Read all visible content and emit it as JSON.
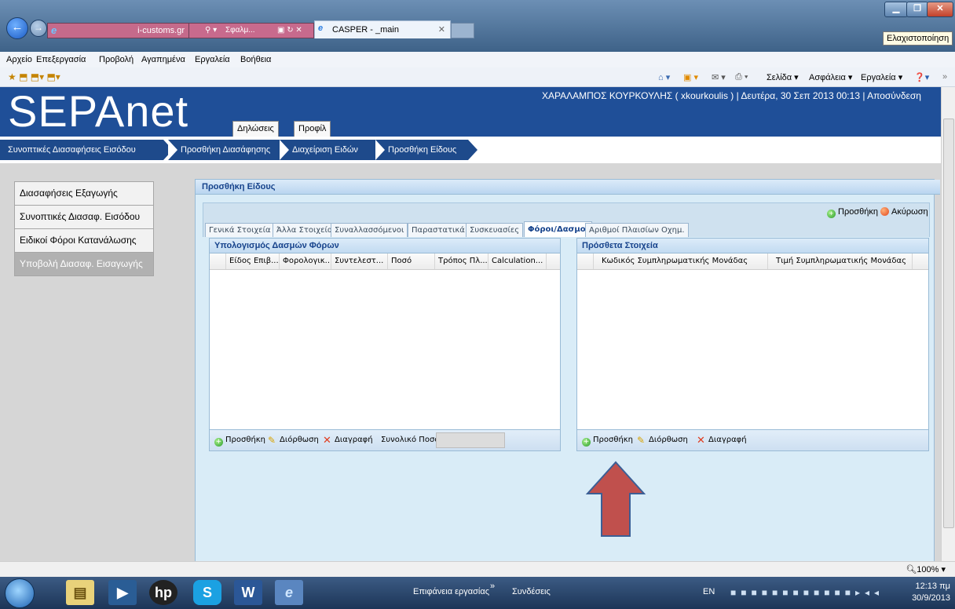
{
  "browser": {
    "address_text": "i-customs.gr",
    "search_tab_text": "Σφαλμ...",
    "active_tab_title": "CASPER - _main",
    "minimize_tooltip": "Ελαχιστοποίηση",
    "menu": [
      "Αρχείο",
      "Επεξεργασία",
      "Προβολή",
      "Αγαπημένα",
      "Εργαλεία",
      "Βοήθεια"
    ],
    "commands": [
      "Σελίδα ▾",
      "Ασφάλεια ▾",
      "Εργαλεία ▾"
    ],
    "zoom": "100%"
  },
  "header": {
    "logo": "SEPAnet",
    "nav_buttons": [
      "Δηλώσεις",
      "Προφίλ"
    ],
    "user_info": "ΧΑΡΑΛΑΜΠΟΣ ΚΟΥΡΚΟΥΛΗΣ ( xkourkoulis ) | Δευτέρα, 30 Σεπ 2013 00:13 | Αποσύνδεση"
  },
  "breadcrumb": [
    "Συνοπτικές Διασαφήσεις Εισόδου",
    "Προσθήκη Διασάφησης",
    "Διαχείριση Ειδών",
    "Προσθήκη Είδους"
  ],
  "sidebar": {
    "items": [
      "Διασαφήσεις Εξαγωγής",
      "Συνοπτικές Διασαφ. Εισόδου",
      "Ειδικοί Φόροι Κατανάλωσης",
      "Υποβολή Διασαφ. Εισαγωγής"
    ],
    "active_index": 3
  },
  "panel": {
    "title": "Προσθήκη Είδους",
    "add_label": "Προσθήκη",
    "cancel_label": "Ακύρωση",
    "tabs": [
      "Γενικά Στοιχεία",
      "Άλλα Στοιχεία",
      "Συναλλασσόμενοι",
      "Παραστατικά",
      "Συσκευασίες",
      "Φόροι/Δασμοί",
      "Αριθμοί Πλαισίων Οχημ."
    ],
    "active_tab": "Φόροι/Δασμοί"
  },
  "duties_grid": {
    "title": "Υπολογισμός Δασμών Φόρων",
    "columns": [
      "Είδος Επιβ...",
      "Φορολογικ...",
      "Συντελεστ...",
      "Ποσό",
      "Τρόπος Πλ...",
      "Calculation..."
    ],
    "footer": {
      "add": "Προσθήκη",
      "edit": "Διόρθωση",
      "delete": "Διαγραφή",
      "total_label": "Συνολικό Ποσό:",
      "total_value": ""
    }
  },
  "extra_grid": {
    "title": "Πρόσθετα Στοιχεία",
    "columns": [
      "Κωδικός Συμπληρωματικής Μονάδας",
      "Τιμή Συμπληρωματικής Μονάδας"
    ],
    "footer": {
      "add": "Προσθήκη",
      "edit": "Διόρθωση",
      "delete": "Διαγραφή"
    }
  },
  "taskbar": {
    "desktop_label": "Επιφάνεια εργασίας",
    "connections_label": "Συνδέσεις",
    "language": "EN",
    "time": "12:13 πμ",
    "date": "30/9/2013"
  },
  "colors": {
    "header_blue": "#1f4f98",
    "arrow_red": "#c0504d",
    "arrow_blue_outline": "#3b5f96"
  }
}
